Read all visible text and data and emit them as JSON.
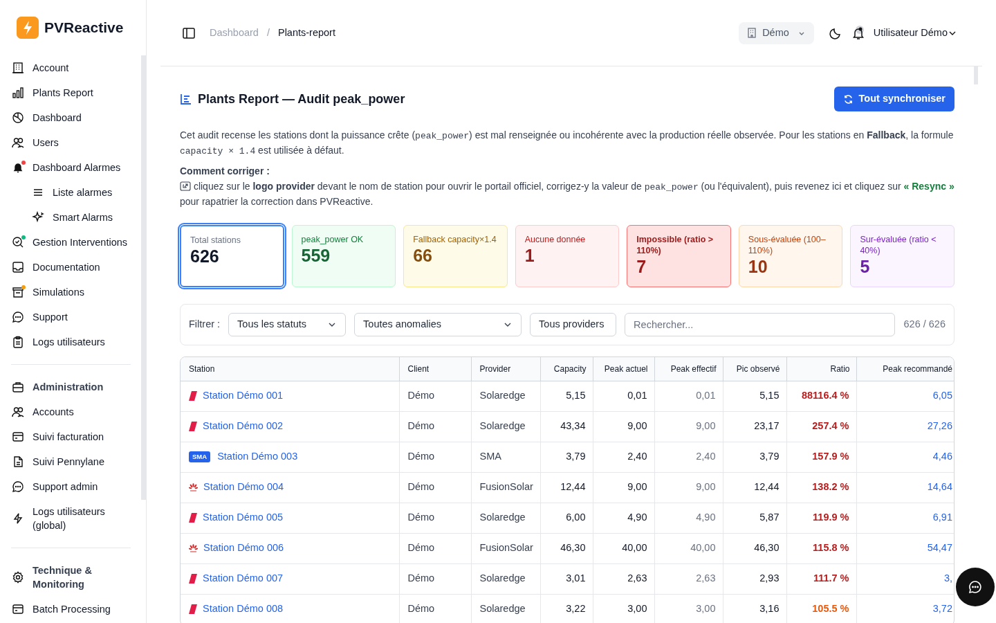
{
  "brand": {
    "name": "PVReactive"
  },
  "sidebar": {
    "groups": [
      {
        "items": [
          {
            "label": "Account"
          },
          {
            "label": "Plants Report"
          },
          {
            "label": "Dashboard"
          },
          {
            "label": "Users"
          },
          {
            "label": "Dashboard Alarmes",
            "color": "#ef4444",
            "children": [
              {
                "label": "Liste alarmes"
              },
              {
                "label": "Smart Alarms"
              }
            ]
          },
          {
            "label": "Gestion Interventions",
            "color": "#10b981"
          },
          {
            "label": "Documentation"
          },
          {
            "label": "Simulations",
            "color": "#f59e0b"
          },
          {
            "label": "Support"
          },
          {
            "label": "Logs utilisateurs"
          }
        ]
      },
      {
        "heading": {
          "label": "Administration"
        },
        "items": [
          {
            "label": "Accounts"
          },
          {
            "label": "Suivi facturation"
          },
          {
            "label": "Suivi Pennylane"
          },
          {
            "label": "Support admin"
          },
          {
            "label": "Logs utilisateurs (global)"
          }
        ]
      },
      {
        "heading": {
          "label": "Technique & Monitoring"
        },
        "items": [
          {
            "label": "Batch Processing"
          }
        ]
      }
    ]
  },
  "breadcrumb": {
    "separator": "/",
    "items": [
      {
        "label": "Dashboard",
        "current": false
      },
      {
        "label": "Plants-report",
        "current": true
      }
    ]
  },
  "header": {
    "org": "Démo",
    "user": "Utilisateur Démo"
  },
  "page": {
    "title": "Plants Report — Audit peak_power",
    "sync_button": "Tout synchroniser",
    "intro": [
      {
        "kind": "text",
        "text": "Cet audit recense les stations dont la puissance crête ("
      },
      {
        "kind": "code",
        "text": "peak_power"
      },
      {
        "kind": "text",
        "text": ") est mal renseignée ou incohérente avec la production réelle observée. Pour les stations en "
      },
      {
        "kind": "bold",
        "text": "Fallback"
      },
      {
        "kind": "text",
        "text": ", la formule "
      },
      {
        "kind": "code",
        "text": "capacity × 1.4"
      },
      {
        "kind": "text",
        "text": " est utilisée à défaut."
      }
    ],
    "howto_title": "Comment corriger :",
    "howto": [
      {
        "kind": "text",
        "text": " cliquez sur le "
      },
      {
        "kind": "bold",
        "text": "logo provider"
      },
      {
        "kind": "text",
        "text": " devant le nom de station pour ouvrir le portail officiel, corrigez-y la valeur de "
      },
      {
        "kind": "code",
        "text": "peak_power"
      },
      {
        "kind": "text",
        "text": " (ou l'équivalent), puis revenez ici et cliquez sur "
      },
      {
        "kind": "green",
        "text": "« Resync »"
      },
      {
        "kind": "text",
        "text": " pour rapatrier la correction dans PVReactive."
      }
    ]
  },
  "stats": [
    {
      "kind": "total",
      "label": "Total stations",
      "value": "626",
      "selected": true
    },
    {
      "kind": "ok",
      "label": "peak_power OK",
      "value": "559",
      "selected": false
    },
    {
      "kind": "fallback",
      "label": "Fallback capacity×1.4",
      "value": "66",
      "selected": false
    },
    {
      "kind": "none",
      "label": "Aucune donnée",
      "value": "1",
      "selected": false
    },
    {
      "kind": "impossible",
      "label": "Impossible (ratio > 110%)",
      "value": "7",
      "selected": false
    },
    {
      "kind": "under",
      "label": "Sous-évaluée (100–110%)",
      "value": "10",
      "selected": false
    },
    {
      "kind": "over",
      "label": "Sur-évaluée (ratio < 40%)",
      "value": "5",
      "selected": false
    }
  ],
  "filters": {
    "label": "Filtrer :",
    "status": "Tous les statuts",
    "anomaly": "Toutes anomalies",
    "provider": "Tous providers",
    "search_placeholder": "Rechercher...",
    "count": "626 / 626"
  },
  "table": {
    "columns": [
      "Station",
      "Client",
      "Provider",
      "Capacity",
      "Peak actuel",
      "Peak effectif",
      "Pic observé",
      "Ratio",
      "Peak recommandé"
    ],
    "rows": [
      {
        "logo": {
          "kind": "stripe"
        },
        "station": "Station Démo 001",
        "client": "Démo",
        "provider": "Solaredge",
        "capacity": "5,15",
        "peak_actuel": "0,01",
        "peak_effectif": "0,01",
        "pic_observe": "5,15",
        "ratio": {
          "text": "88116.4 %",
          "kind": "critical"
        },
        "peak_recommande": "6,05"
      },
      {
        "logo": {
          "kind": "stripe"
        },
        "station": "Station Démo 002",
        "client": "Démo",
        "provider": "Solaredge",
        "capacity": "43,34",
        "peak_actuel": "9,00",
        "peak_effectif": "9,00",
        "pic_observe": "23,17",
        "ratio": {
          "text": "257.4 %",
          "kind": "critical"
        },
        "peak_recommande": "27,26"
      },
      {
        "logo": {
          "kind": "badge",
          "text": "SMA"
        },
        "station": "Station Démo 003",
        "client": "Démo",
        "provider": "SMA",
        "capacity": "3,79",
        "peak_actuel": "2,40",
        "peak_effectif": "2,40",
        "pic_observe": "3,79",
        "ratio": {
          "text": "157.9 %",
          "kind": "critical"
        },
        "peak_recommande": "4,46"
      },
      {
        "logo": {
          "kind": "flower"
        },
        "station": "Station Démo 004",
        "client": "Démo",
        "provider": "FusionSolar",
        "capacity": "12,44",
        "peak_actuel": "9,00",
        "peak_effectif": "9,00",
        "pic_observe": "12,44",
        "ratio": {
          "text": "138.2 %",
          "kind": "critical"
        },
        "peak_recommande": "14,64"
      },
      {
        "logo": {
          "kind": "stripe"
        },
        "station": "Station Démo 005",
        "client": "Démo",
        "provider": "Solaredge",
        "capacity": "6,00",
        "peak_actuel": "4,90",
        "peak_effectif": "4,90",
        "pic_observe": "5,87",
        "ratio": {
          "text": "119.9 %",
          "kind": "critical"
        },
        "peak_recommande": "6,91"
      },
      {
        "logo": {
          "kind": "flower"
        },
        "station": "Station Démo 006",
        "client": "Démo",
        "provider": "FusionSolar",
        "capacity": "46,30",
        "peak_actuel": "40,00",
        "peak_effectif": "40,00",
        "pic_observe": "46,30",
        "ratio": {
          "text": "115.8 %",
          "kind": "critical"
        },
        "peak_recommande": "54,47"
      },
      {
        "logo": {
          "kind": "stripe"
        },
        "station": "Station Démo 007",
        "client": "Démo",
        "provider": "Solaredge",
        "capacity": "3,01",
        "peak_actuel": "2,63",
        "peak_effectif": "2,63",
        "pic_observe": "2,93",
        "ratio": {
          "text": "111.7 %",
          "kind": "critical"
        },
        "peak_recommande": "3,"
      },
      {
        "logo": {
          "kind": "stripe"
        },
        "station": "Station Démo 008",
        "client": "Démo",
        "provider": "Solaredge",
        "capacity": "3,22",
        "peak_actuel": "3,00",
        "peak_effectif": "3,00",
        "pic_observe": "3,16",
        "ratio": {
          "text": "105.5 %",
          "kind": "warning"
        },
        "peak_recommande": "3,72"
      }
    ]
  }
}
